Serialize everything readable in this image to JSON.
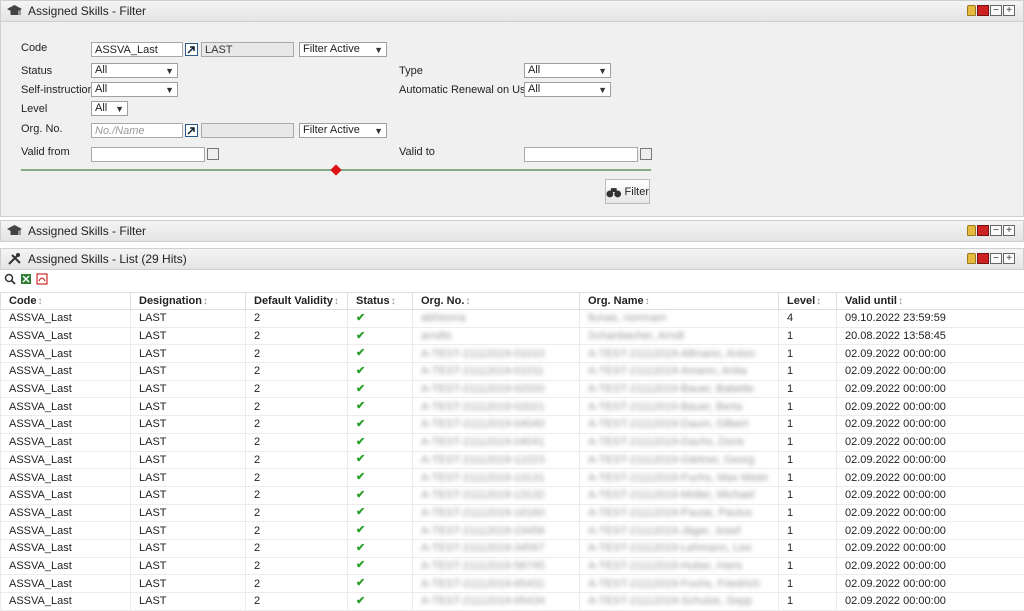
{
  "filter_panel": {
    "title": "Assigned Skills - Filter",
    "code_label": "Code",
    "code_value": "ASSVA_Last",
    "code_desc": "LAST",
    "code_filter": "Filter Active",
    "status_label": "Status",
    "status_value": "All",
    "type_label": "Type",
    "type_value": "All",
    "self_label": "Self-instruction",
    "self_value": "All",
    "renewal_label": "Automatic Renewal on Use",
    "renewal_value": "All",
    "level_label": "Level",
    "level_value": "All",
    "org_label": "Org. No.",
    "org_placeholder": "No./Name",
    "org_filter": "Filter Active",
    "valid_from_label": "Valid from",
    "valid_to_label": "Valid to",
    "filter_button": "Filter"
  },
  "collapsed_panel": {
    "title": "Assigned Skills - Filter"
  },
  "list_panel": {
    "title": "Assigned Skills - List (29 Hits)"
  },
  "table": {
    "columns": [
      "Code",
      "Designation",
      "Default Validity",
      "Status",
      "Org. No.",
      "Org. Name",
      "Level",
      "Valid until"
    ],
    "rows": [
      [
        "ASSVA_Last",
        "LAST",
        "2",
        "✔",
        "abhisona",
        "ltunas, nomnam",
        "4",
        "09.10.2022 23:59:59"
      ],
      [
        "ASSVA_Last",
        "LAST",
        "2",
        "✔",
        "arndts",
        "Schanbacher, Arndt",
        "1",
        "20.08.2022 13:58:45"
      ],
      [
        "ASSVA_Last",
        "LAST",
        "2",
        "✔",
        "A-TEST-21112019-01010",
        "A-TEST-21112019-Allmann, Anton",
        "1",
        "02.09.2022 00:00:00"
      ],
      [
        "ASSVA_Last",
        "LAST",
        "2",
        "✔",
        "A-TEST-21112019-01011",
        "A-TEST-21112019-Amann, Anita",
        "1",
        "02.09.2022 00:00:00"
      ],
      [
        "ASSVA_Last",
        "LAST",
        "2",
        "✔",
        "A-TEST-21112019-02020",
        "A-TEST-21112019-Bauer, Babette",
        "1",
        "02.09.2022 00:00:00"
      ],
      [
        "ASSVA_Last",
        "LAST",
        "2",
        "✔",
        "A-TEST-21112019-02021",
        "A-TEST-21112019-Bauer, Berta",
        "1",
        "02.09.2022 00:00:00"
      ],
      [
        "ASSVA_Last",
        "LAST",
        "2",
        "✔",
        "A-TEST-21112019-04040",
        "A-TEST-21112019-Daum, Dilbert",
        "1",
        "02.09.2022 00:00:00"
      ],
      [
        "ASSVA_Last",
        "LAST",
        "2",
        "✔",
        "A-TEST-21112019-04041",
        "A-TEST-21112019-Dachs, Doris",
        "1",
        "02.09.2022 00:00:00"
      ],
      [
        "ASSVA_Last",
        "LAST",
        "2",
        "✔",
        "A-TEST-21112019-12223",
        "A-TEST-21112019-Gärtner, Georg",
        "1",
        "02.09.2022 00:00:00"
      ],
      [
        "ASSVA_Last",
        "LAST",
        "2",
        "✔",
        "A-TEST-21112019-13131",
        "A-TEST-21112019-Fuchs, Max Meier",
        "1",
        "02.09.2022 00:00:00"
      ],
      [
        "ASSVA_Last",
        "LAST",
        "2",
        "✔",
        "A-TEST-21112019-13132",
        "A-TEST-21112019-Müller, Michael",
        "1",
        "02.09.2022 00:00:00"
      ],
      [
        "ASSVA_Last",
        "LAST",
        "2",
        "✔",
        "A-TEST-21112019-16160",
        "A-TEST-21112019-Pause, Paulus",
        "1",
        "02.09.2022 00:00:00"
      ],
      [
        "ASSVA_Last",
        "LAST",
        "2",
        "✔",
        "A-TEST-21112019-23456",
        "A-TEST-21112019-Jäger, Josef",
        "1",
        "02.09.2022 00:00:00"
      ],
      [
        "ASSVA_Last",
        "LAST",
        "2",
        "✔",
        "A-TEST-21112019-34567",
        "A-TEST-21112019-Lehmann, Leo",
        "1",
        "02.09.2022 00:00:00"
      ],
      [
        "ASSVA_Last",
        "LAST",
        "2",
        "✔",
        "A-TEST-21112019-56745",
        "A-TEST-21112019-Huber, Hans",
        "1",
        "02.09.2022 00:00:00"
      ],
      [
        "ASSVA_Last",
        "LAST",
        "2",
        "✔",
        "A-TEST-21112019-65431",
        "A-TEST-21112019-Fuchs, Friedrich",
        "1",
        "02.09.2022 00:00:00"
      ],
      [
        "ASSVA_Last",
        "LAST",
        "2",
        "✔",
        "A-TEST-21112019-65434",
        "A-TEST-21112019-Schulze, Sepp",
        "1",
        "02.09.2022 00:00:00"
      ]
    ]
  },
  "colors": {
    "status_ok": "#2aa02a",
    "slider_knob": "#dd1111",
    "panel_bg": "#f0f0f0"
  }
}
